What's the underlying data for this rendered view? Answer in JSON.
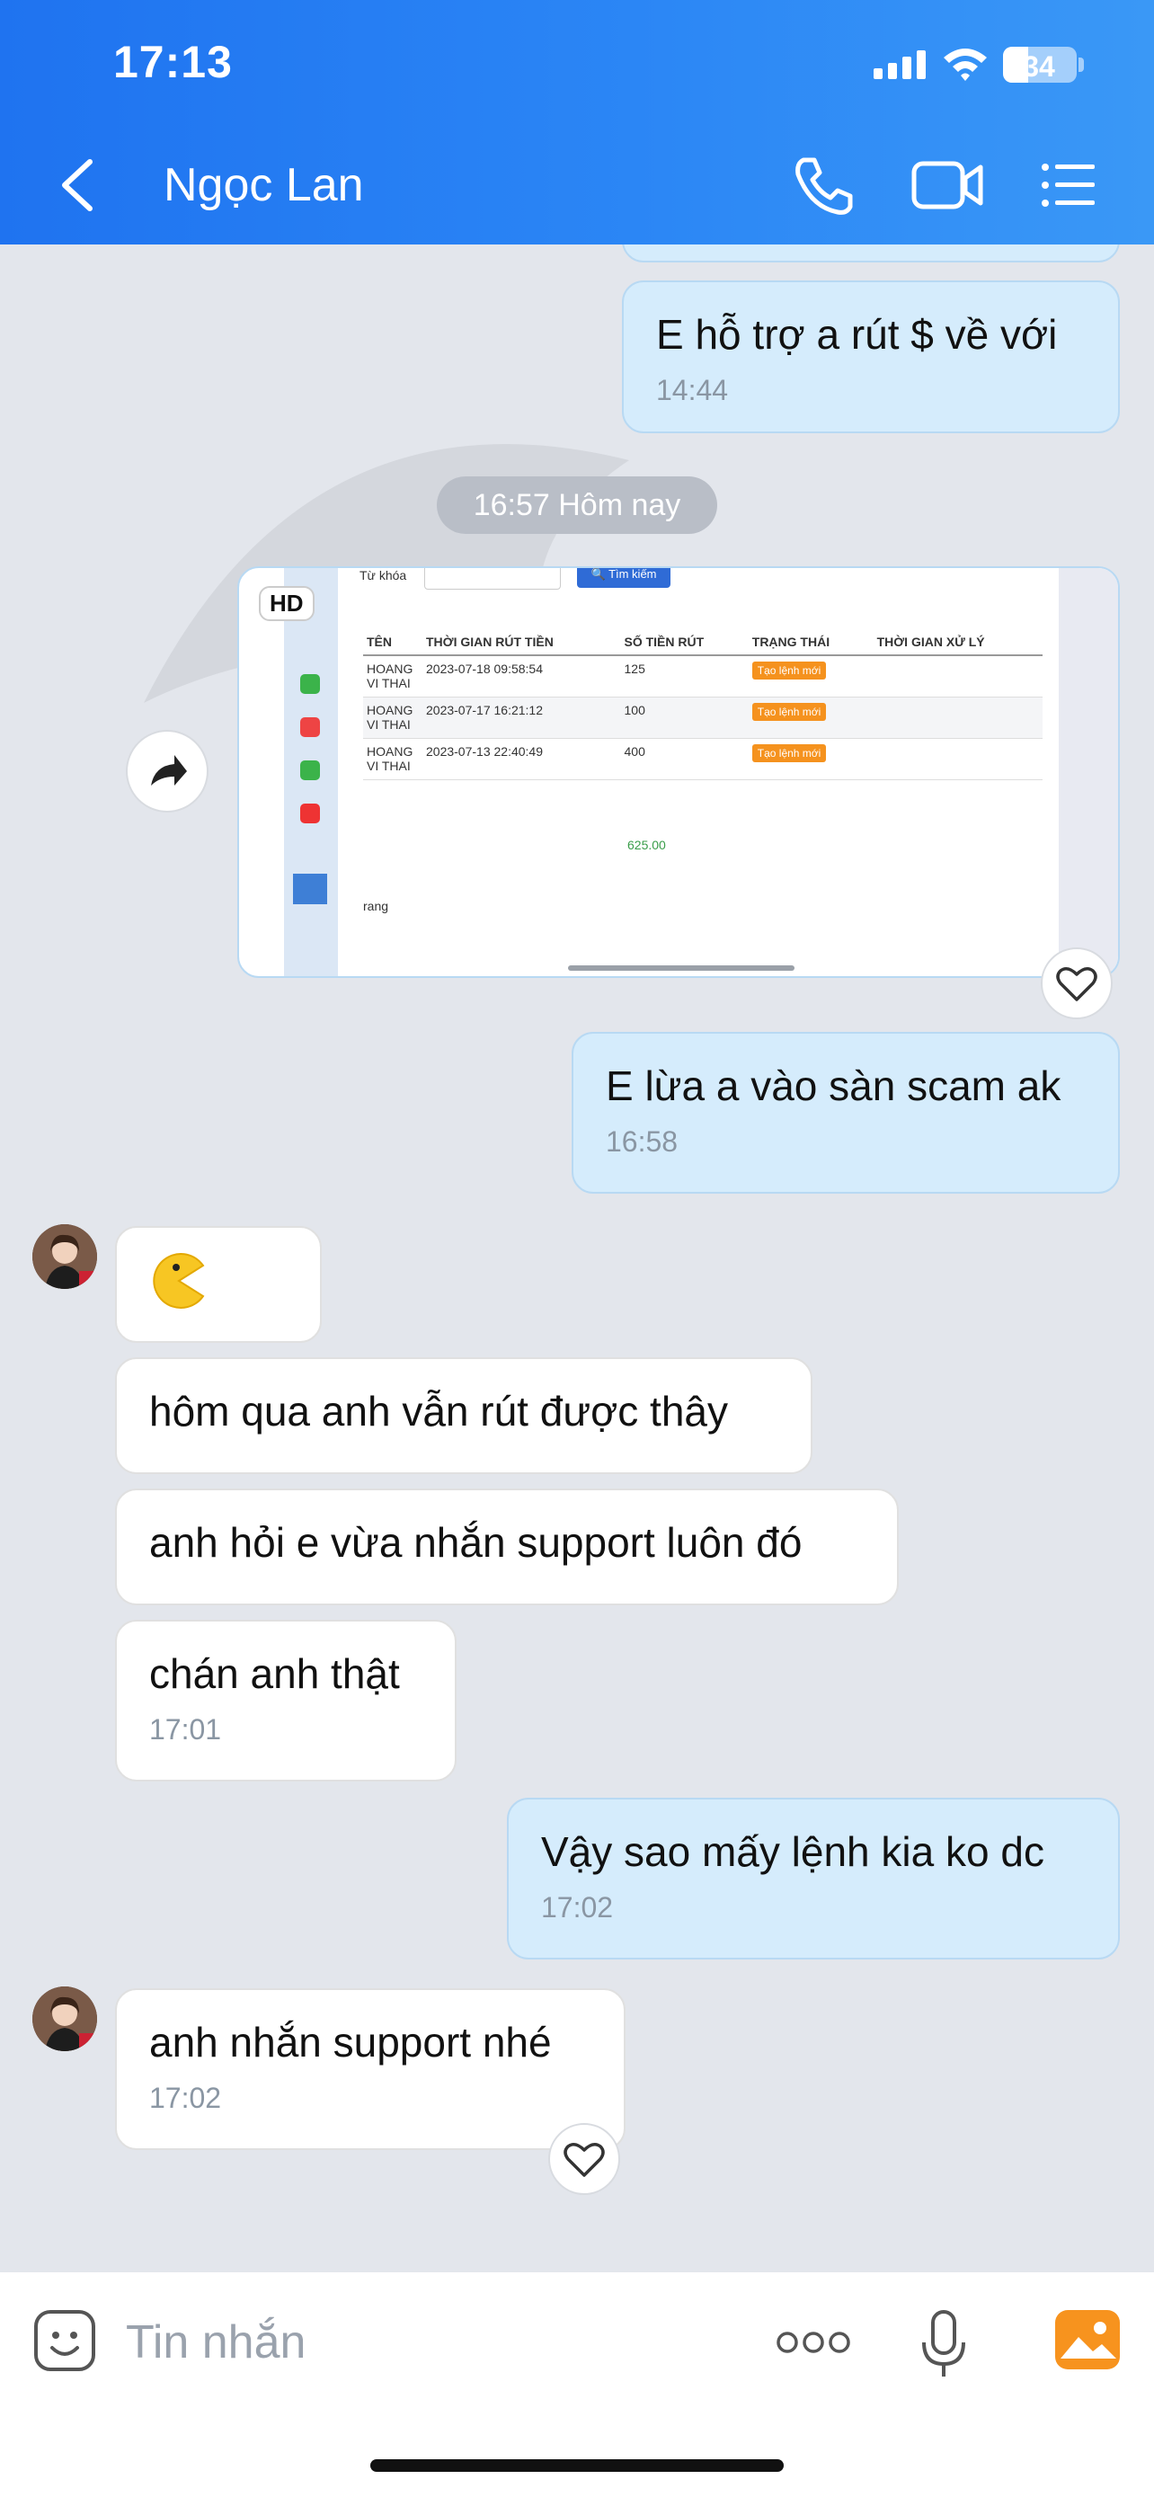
{
  "status_bar": {
    "time": "17:13",
    "battery": "34"
  },
  "header": {
    "contact_name": "Ngọc Lan"
  },
  "chat": {
    "date_separator": "16:57 Hôm nay",
    "messages": [
      {
        "text": "E hỗ trợ a rút $ về với",
        "time": "14:44"
      },
      {
        "text": "E lừa a vào sàn scam ak",
        "time": "16:58"
      },
      {
        "text": "hôm qua anh vẫn rút được thây"
      },
      {
        "text": "anh hỏi e vừa nhắn support luôn đó"
      },
      {
        "text": "chán anh thật",
        "time": "17:01"
      },
      {
        "text": "Vậy sao mấy lệnh kia ko dc",
        "time": "17:02"
      },
      {
        "text": "anh nhắn support nhé",
        "time": "17:02"
      }
    ],
    "image_message": {
      "badge": "HD",
      "keyword_label": "Từ khóa",
      "search_button": "Tìm kiếm",
      "columns": [
        "TÊN",
        "THỜI GIAN RÚT TIỀN",
        "SỐ TIỀN RÚT",
        "TRẠNG THÁI",
        "THỜI GIAN XỬ LÝ"
      ],
      "rows": [
        {
          "name": "HOANG VI THAI",
          "time": "2023-07-18 09:58:54",
          "amount": "125",
          "status": "Tạo lệnh mới"
        },
        {
          "name": "HOANG VI THAI",
          "time": "2023-07-17 16:21:12",
          "amount": "100",
          "status": "Tạo lệnh mới"
        },
        {
          "name": "HOANG VI THAI",
          "time": "2023-07-13 22:40:49",
          "amount": "400",
          "status": "Tạo lệnh mới"
        }
      ],
      "total": "625.00",
      "footer": "rang"
    }
  },
  "input": {
    "placeholder": "Tin nhắn"
  },
  "colors": {
    "header_blue": "#2b86f5",
    "outgoing_bubble": "#d5ecfc",
    "incoming_bubble": "#ffffff",
    "status_tag": "#f5921e",
    "photo_icon": "#f7931e"
  }
}
